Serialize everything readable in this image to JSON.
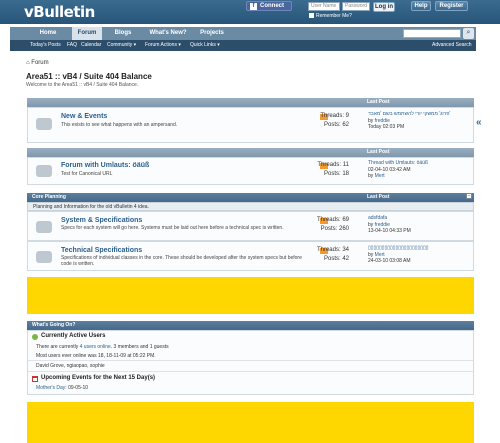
{
  "header": {
    "logo": "vBulletin",
    "connect_label": "Connect",
    "connect_f": "f",
    "username_placeholder": "User Name",
    "password_placeholder": "Password",
    "login_label": "Log in",
    "remember_label": "Remember Me?",
    "help_label": "Help",
    "register_label": "Register"
  },
  "nav": {
    "tabs": [
      "Home",
      "Forum",
      "Blogs",
      "What's New?",
      "Projects"
    ],
    "sub": [
      "Today's Posts",
      "FAQ",
      "Calendar",
      "Community ▾",
      "Forum Actions ▾",
      "Quick Links ▾"
    ],
    "advanced_search": "Advanced Search"
  },
  "breadcrumb": "Forum",
  "page_title": "Area51 :: vB4 / Suite 404 Balance",
  "welcome": "Welcome to the Area51 :: vB4 / Suite 404 Balance.",
  "headers": {
    "last_post": "Last Post"
  },
  "forums1": {
    "name": "New & Events",
    "desc": "This exists to see what happens with an ampersand.",
    "threads": "Threads: 9",
    "posts": "Posts: 62",
    "lp_title": "פרוג' ממשקי יורי להשתמש בשם 'מאבד'",
    "lp_by": "by",
    "lp_user": "freddie",
    "lp_time": "Today 02:03 PM"
  },
  "forums2": {
    "name": "Forum with Umlauts: öäüß",
    "desc": "Test for Canonical URL",
    "threads": "Threads: 11",
    "posts": "Posts: 18",
    "lp_title": "Thread with Umlauts: öäüß",
    "lp_time": "02-04-10 03:42 AM",
    "lp_by": "by",
    "lp_user": "Mert"
  },
  "category": {
    "name": "Core Planning",
    "last_post": "Last Post",
    "desc": "Planning and Information for the old vBulletin 4 idea.",
    "forums": [
      {
        "name": "System & Specifications",
        "desc": "Specs for each system will go here. Systems must be laid out here before a technical spec is written.",
        "threads": "Threads: 69",
        "posts": "Posts: 260",
        "lp_title": "adsfdafa",
        "lp_by": "by",
        "lp_user": "freddie",
        "lp_time": "13-04-10 04:33 PM"
      },
      {
        "name": "Technical Specifications",
        "desc": "Specifications of individual classes in the core. These should be developed after the system specs but before code is written.",
        "threads": "Threads: 34",
        "posts": "Posts: 42",
        "lp_title": "▯▯▯▯▯▯▯▯▯▯▯▯▯▯▯▯▯▯▯▯▯▯",
        "lp_by": "by",
        "lp_user": "Mert",
        "lp_time": "24-03-10 03:08 AM"
      }
    ]
  },
  "whats_going_on": {
    "title": "What's Going On?",
    "active_title": "Currently Active Users",
    "active_line_pre": "There are currently",
    "active_line_link": "4 users online",
    "active_line_post": ". 3 members and 1 guests",
    "most_users": "Most users ever online was 18, 18-11-09 at 05:22 PM.",
    "members": "David Grove, ngiaopao, sophie",
    "events_title": "Upcoming Events for the Next 15 Day(s)",
    "event": "Mother's Day",
    "event_date": ": 09-05-10"
  },
  "colors": {
    "header": "#2f5f85",
    "ad_yellow": "#ffd700",
    "link": "#2b5f8f"
  }
}
